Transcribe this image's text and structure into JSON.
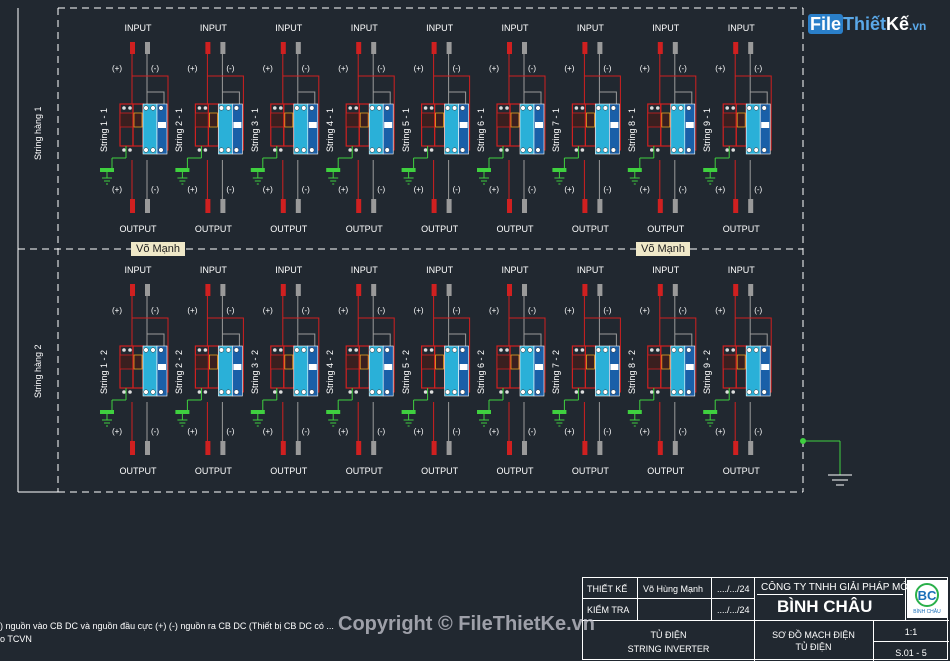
{
  "diagram": {
    "input_label": "INPUT",
    "output_label": "OUTPUT",
    "plus_label": "(+)",
    "minus_label": "(-)",
    "rows": [
      {
        "string_label": "String hàng 1",
        "units": [
          "String 1 - 1",
          "String 2 - 1",
          "String 3 - 1",
          "String 4 - 1",
          "String 5 - 1",
          "String 6 - 1",
          "String 7 - 1",
          "String 8 - 1",
          "String 9 - 1"
        ]
      },
      {
        "string_label": "String hàng 2",
        "units": [
          "String 1 - 2",
          "String 2 - 2",
          "String 3 - 2",
          "String 4 - 2",
          "String 5 - 2",
          "String 6 - 2",
          "String 7 - 2",
          "String 8 - 2",
          "String 9 - 2"
        ]
      }
    ],
    "tags": [
      "Võ Mạnh",
      "Võ Mạnh"
    ],
    "colors": {
      "background": "#212830",
      "positive_wire": "#d02020",
      "negative_wire": "#9a9a9a",
      "breaker_panel": "#2ab0d8",
      "ground": "#3fd03f",
      "frame": "#ffffff"
    }
  },
  "logo": {
    "part1": "File",
    "part2": "Thiết",
    "part3": "Kế",
    ".vn": ".vn",
    "suffix": ".vn"
  },
  "notes": {
    "line1": ") nguồn vào CB DC và nguồn đầu cực (+) (-) nguồn ra CB DC (Thiết bị CB DC có ... ",
    "line2": "o TCVN"
  },
  "copyright": "Copyright © FileThietKe.vn",
  "title_block": {
    "designed_label": "THIẾT KẾ",
    "designer": "Võ Hùng Mạnh",
    "date1": "..../.../24",
    "checked_label": "KIỂM TRA",
    "date2": "..../.../24",
    "company": "CÔNG TY TNHH GIẢI PHÁP MỚI",
    "company_name": "BÌNH CHÂU",
    "logo_text": "BÌNH CHÂU",
    "panel_line1": "TỦ ĐIỆN",
    "panel_line2": "STRING INVERTER",
    "drawing_line1": "SƠ ĐỒ MẠCH ĐIỆN",
    "drawing_line2": "TỦ ĐIỆN",
    "scale": "1:1",
    "sheet": "S.01 - 5"
  }
}
